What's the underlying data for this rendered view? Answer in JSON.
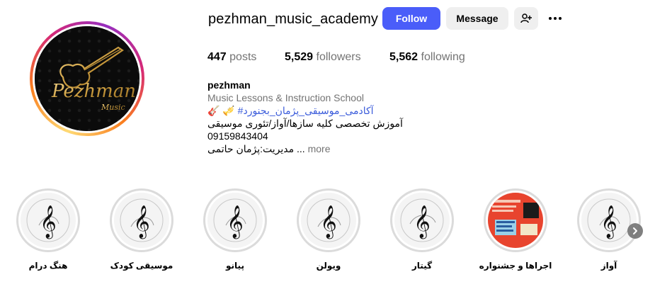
{
  "profile": {
    "username": "pezhman_music_academy",
    "avatar_logo_text": "Pezhman",
    "avatar_logo_subtext": "Music"
  },
  "actions": {
    "follow_label": "Follow",
    "message_label": "Message",
    "add_user_icon": "add-user-icon",
    "more_icon": "more-options-icon"
  },
  "stats": {
    "posts_count": "447",
    "posts_label": "posts",
    "followers_count": "5,529",
    "followers_label": "followers",
    "following_count": "5,562",
    "following_label": "following"
  },
  "bio": {
    "name": "pezhman",
    "category": "Music Lessons & Instruction School",
    "hashtag": "#آکادمی_موسیقی_پژمان_بجنورد",
    "hashtag_emojis": "🎸 🎺",
    "line1": "آموزش تخصصی کلیه سازها/آواز/تئوری موسیقی",
    "line2": "09159843404",
    "line3": "مدیریت:پژمان حاتمی ...",
    "more_label": "more"
  },
  "highlights": [
    {
      "label": "هنگ درام"
    },
    {
      "label": "موسیقی کودک"
    },
    {
      "label": "پیانو"
    },
    {
      "label": "ویولن"
    },
    {
      "label": "گیتار"
    },
    {
      "label": "اجراها و جشنواره"
    },
    {
      "label": "آواز"
    }
  ],
  "colors": {
    "follow_button": "#4a5df9",
    "secondary_button": "#efefef",
    "hashtag_link": "#3b5cdb",
    "muted_text": "#737373",
    "highlight_poster_red": "#e8442e"
  }
}
